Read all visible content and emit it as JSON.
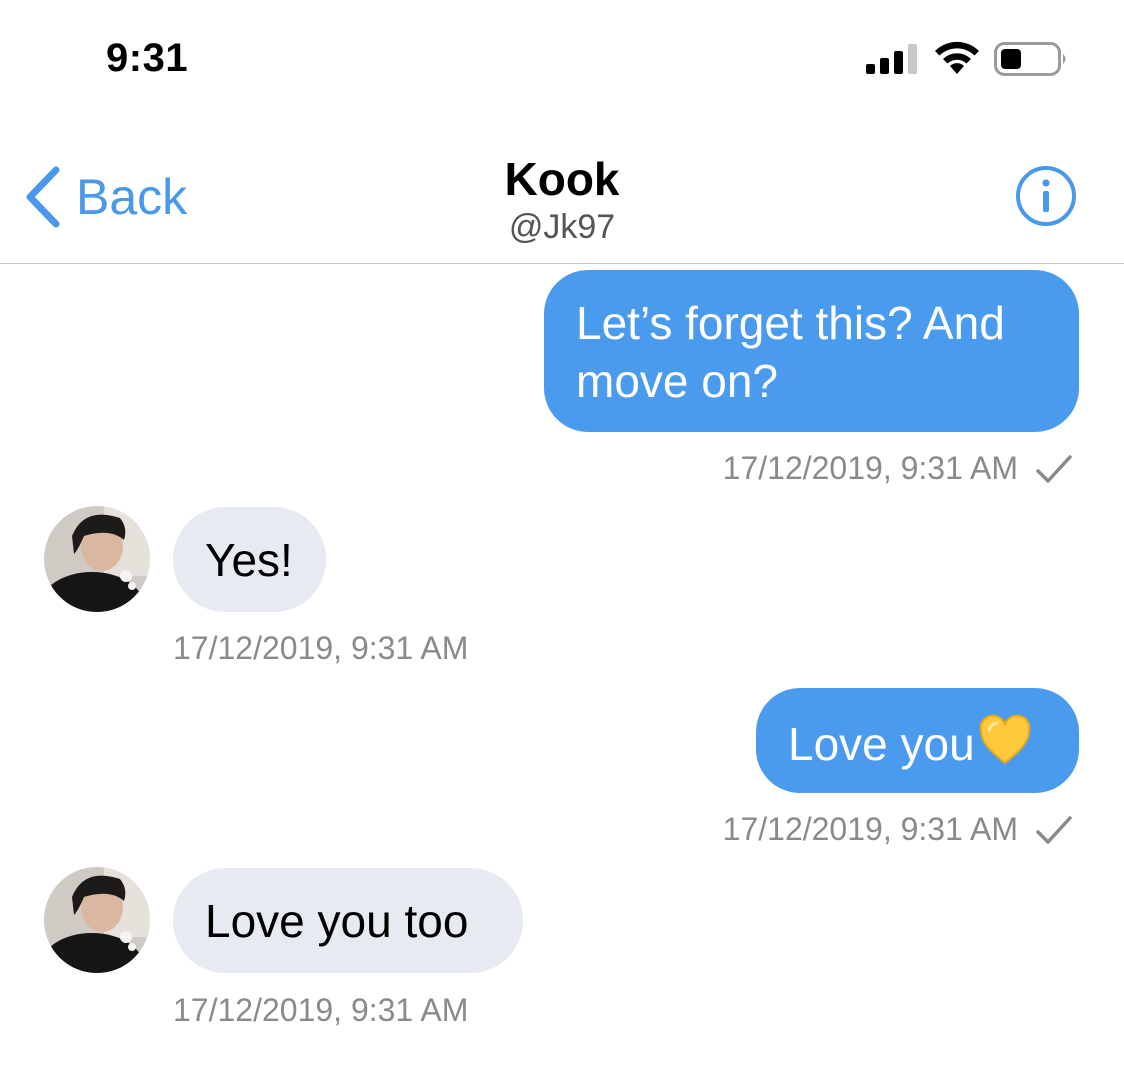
{
  "status_bar": {
    "time": "9:31",
    "signal_icon": "cellular-signal-icon",
    "wifi_icon": "wifi-icon",
    "battery_icon": "battery-icon"
  },
  "header": {
    "back_label": "Back",
    "title": "Kook",
    "handle": "@Jk97",
    "info_icon": "info-icon",
    "accent_color": "#4a98ea"
  },
  "messages": [
    {
      "direction": "outgoing",
      "text": "Let’s forget this? And move on?",
      "timestamp": "17/12/2019, 9:31 AM",
      "read_icon": "checkmark-icon"
    },
    {
      "direction": "incoming",
      "text": "Yes!",
      "timestamp": "17/12/2019, 9:31 AM",
      "avatar_icon": "avatar-photo"
    },
    {
      "direction": "outgoing",
      "text": "Love you",
      "emoji": "yellow-heart-icon",
      "timestamp": "17/12/2019, 9:31 AM",
      "read_icon": "checkmark-icon"
    },
    {
      "direction": "incoming",
      "text": "Love you too",
      "timestamp": "17/12/2019, 9:31 AM",
      "avatar_icon": "avatar-photo"
    }
  ],
  "colors": {
    "outgoing_bubble": "#4a9bee",
    "incoming_bubble": "#e7eaf1",
    "timestamp": "#8a8a8e"
  }
}
